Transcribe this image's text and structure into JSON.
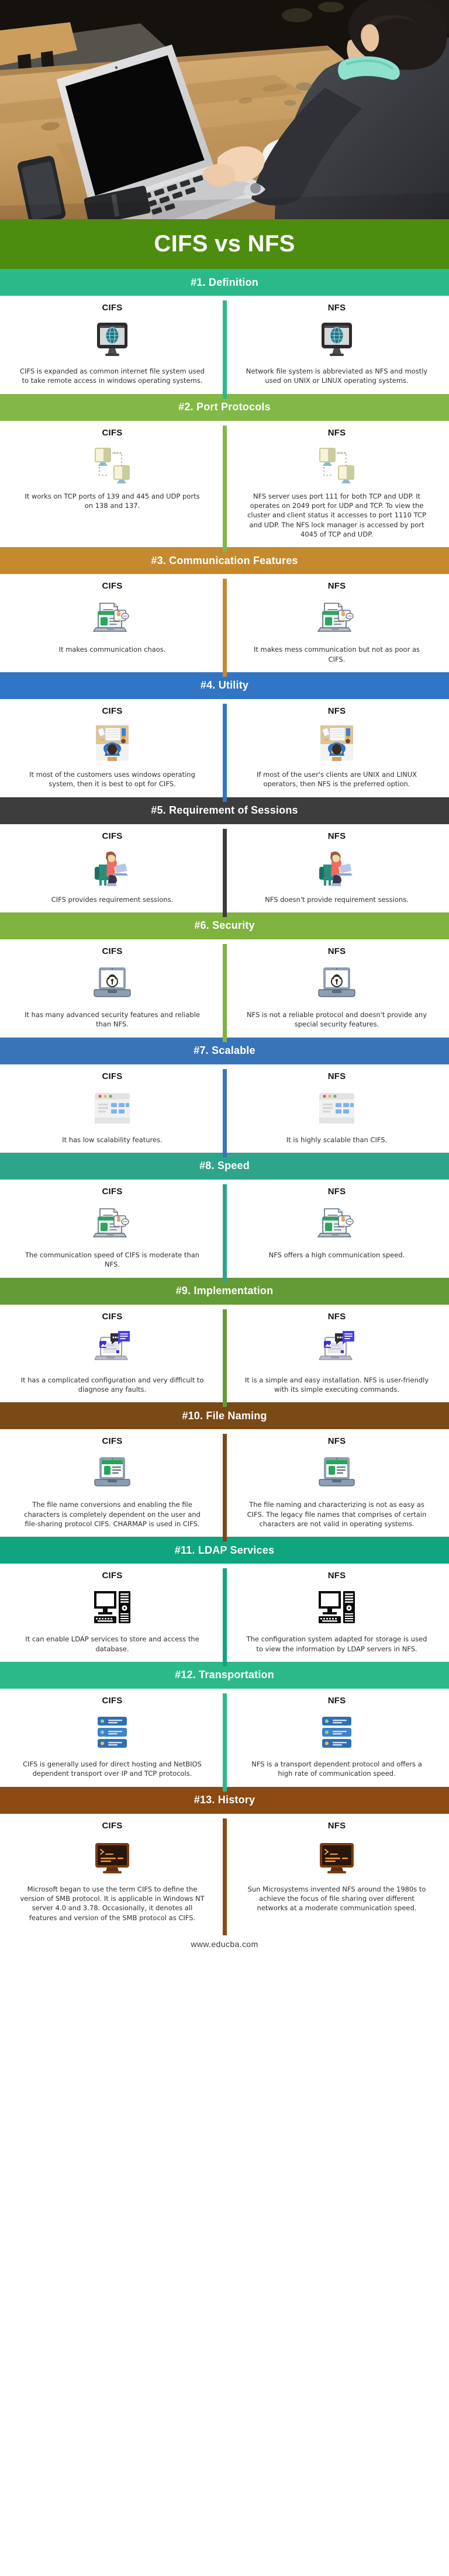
{
  "hero": {
    "alt": "man-typing-on-laptop-at-wooden-table-photo"
  },
  "title": "CIFS vs NFS",
  "title_color": "#4c8c0e",
  "col_labels": {
    "left": "CIFS",
    "right": "NFS"
  },
  "footer": {
    "url": "www.educba.com"
  },
  "sections": [
    {
      "heading": "#1. Definition",
      "color": "#2bb98a",
      "icon": "monitor-globe-icon",
      "left": "CIFS is expanded as common internet file system used to take remote access in windows operating systems.",
      "right": "Network file system is abbreviated as NFS and mostly used on UNIX or LINUX operating systems."
    },
    {
      "heading": "#2. Port Protocols",
      "color": "#82b846",
      "icon": "two-monitors-network-icon",
      "left": "It works on TCP ports of 139 and 445 and UDP ports on 138 and 137.",
      "right": "NFS server uses port 111 for both TCP and UDP. It operates on 2049 port for UDP and TCP. To view the cluster and client status it accesses to port 1110 TCP and UDP. The NFS lock manager is accessed by port 4045 of TCP and UDP."
    },
    {
      "heading": "#3. Communication Features",
      "color": "#c68a2e",
      "icon": "laptop-chat-document-icon",
      "left": "It makes communication chaos.",
      "right": "It makes mess communication but not as poor as CIFS."
    },
    {
      "heading": "#4. Utility",
      "color": "#3176c4",
      "icon": "desk-top-view-person-icon",
      "left": "It most of the customers uses windows operating system, then it is best to opt for CIFS.",
      "right": "If most of the user's clients are UNIX and LINUX operators, then NFS is the preferred option."
    },
    {
      "heading": "#5. Requirement of Sessions",
      "color": "#3d3d3d",
      "icon": "person-sitting-armchair-laptop-icon",
      "left": "CIFS provides requirement sessions.",
      "right": "NFS doesn't provide requirement sessions."
    },
    {
      "heading": "#6. Security",
      "color": "#7fb23f",
      "icon": "laptop-padlock-icon",
      "left": "It has many advanced security features and reliable than NFS.",
      "right": "NFS is not a reliable protocol and doesn't provide any special security features."
    },
    {
      "heading": "#7. Scalable",
      "color": "#3a74b8",
      "icon": "browser-window-dashboard-icon",
      "left": "It has low scalability features.",
      "right": "It is highly scalable than CIFS."
    },
    {
      "heading": "#8. Speed",
      "color": "#2ea58a",
      "icon": "laptop-chat-document-icon",
      "left": "The communication speed of CIFS is moderate than NFS.",
      "right": "NFS offers a high communication speed."
    },
    {
      "heading": "#9. Implementation",
      "color": "#659b36",
      "icon": "laptop-chat-bubbles-icon",
      "left": "It has a complicated configuration and very difficult to diagnose any faults.",
      "right": "It is a simple and easy installation. NFS is user-friendly with its simple executing commands."
    },
    {
      "heading": "#10. File Naming",
      "color": "#7a4a16",
      "icon": "laptop-green-header-page-icon",
      "left": "The file name conversions and enabling the file characters is completely dependent on the user and file-sharing protocol CIFS. CHARMAP is used in CIFS.",
      "right": "The file naming and characterizing is not as easy as CIFS. The legacy file names that comprises of certain characters are not valid in operating systems."
    },
    {
      "heading": "#11. LDAP Services",
      "color": "#0fa57f",
      "icon": "desktop-computer-tower-icon",
      "left": "It can enable LDAP services to store and access the database.",
      "right": "The configuration system adapted for storage is used to view the information by LDAP servers in NFS."
    },
    {
      "heading": "#12. Transportation",
      "color": "#2bb98a",
      "icon": "server-rack-transport-icon",
      "left": "CIFS is generally used for direct hosting and NetBIOS dependent transport over IP and TCP protocols.",
      "right": "NFS is a transport dependent protocol and offers a high rate of communication speed."
    },
    {
      "heading": "#13. History",
      "color": "#8b4a12",
      "icon": "terminal-console-icon",
      "left": "Microsoft began to use the term CIFS to define the version of SMB protocol. It is applicable in Windows NT server 4.0 and 3.78. Occasionally, it denotes all features and version of the SMB protocol as CIFS.",
      "right": "Sun Microsystems invented NFS around the 1980s to achieve the focus of file sharing over different networks at a moderate communication speed."
    }
  ]
}
